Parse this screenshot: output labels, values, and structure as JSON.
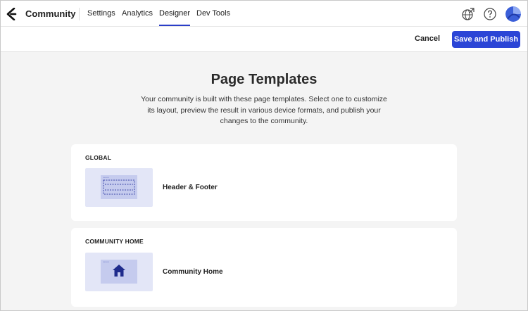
{
  "app": {
    "brand": "Community"
  },
  "nav": {
    "items": [
      {
        "label": "Settings"
      },
      {
        "label": "Analytics"
      },
      {
        "label": "Designer",
        "active": true
      },
      {
        "label": "Dev Tools"
      }
    ]
  },
  "header_icons": [
    "globe-external-icon",
    "help-icon",
    "avatar"
  ],
  "actions": {
    "cancel_label": "Cancel",
    "publish_label": "Save and Publish"
  },
  "page": {
    "title": "Page Templates",
    "description": "Your community is built with these page templates. Select one to customize its layout, preview the result in various device formats, and publish your changes to the community."
  },
  "sections": [
    {
      "label": "GLOBAL",
      "templates": [
        {
          "name": "Header & Footer",
          "icon": "header-footer-layout-icon"
        }
      ]
    },
    {
      "label": "COMMUNITY HOME",
      "templates": [
        {
          "name": "Community Home",
          "icon": "home-icon"
        }
      ]
    }
  ],
  "colors": {
    "accent": "#2b45d6",
    "thumb_bg": "#e3e6f7",
    "thumb_inner": "#c5cbee",
    "page_bg": "#f4f4f4"
  }
}
